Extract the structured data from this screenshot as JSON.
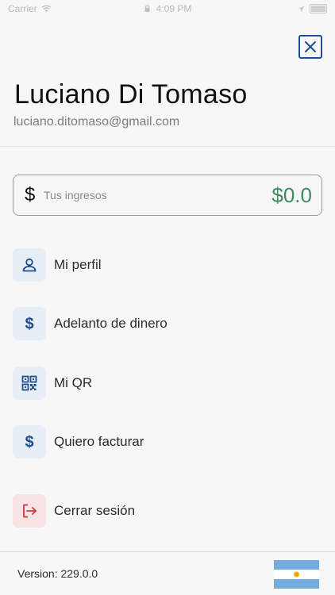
{
  "status_bar": {
    "carrier": "Carrier",
    "time": "4:09 PM"
  },
  "user": {
    "name": "Luciano Di Tomaso",
    "email": "luciano.ditomaso@gmail.com"
  },
  "income": {
    "currency_symbol": "$",
    "placeholder": "Tus ingresos",
    "amount": "$0.0"
  },
  "menu": {
    "items": [
      {
        "label": "Mi perfil",
        "icon": "user-icon"
      },
      {
        "label": "Adelanto de dinero",
        "icon": "dollar-icon"
      },
      {
        "label": "Mi QR",
        "icon": "qr-code-icon"
      },
      {
        "label": "Quiero facturar",
        "icon": "dollar-icon"
      },
      {
        "label": "Cerrar sesión",
        "icon": "logout-icon"
      }
    ]
  },
  "footer": {
    "version": "Version: 229.0.0",
    "flag": "argentina-flag"
  },
  "colors": {
    "accent_blue": "#1f4e8c",
    "amount_green": "#3e8a64",
    "logout_red": "#d33a3a",
    "icon_bg": "#e8eef6",
    "logout_icon_bg": "#f8e4e5"
  }
}
